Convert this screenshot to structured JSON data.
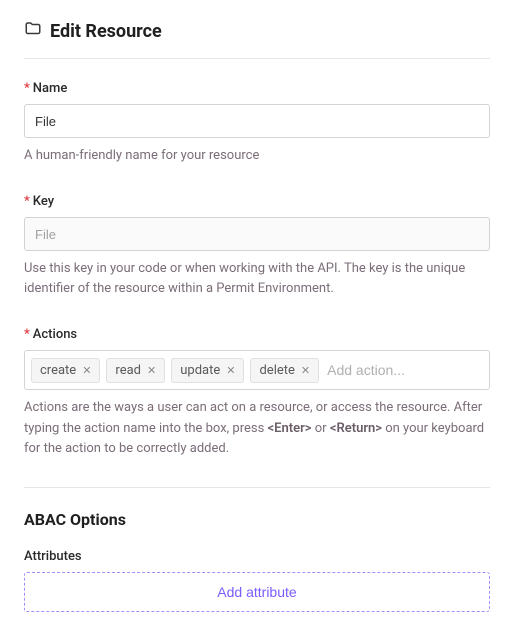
{
  "header": {
    "title": "Edit Resource",
    "icon": "folder-icon"
  },
  "fields": {
    "name": {
      "label": "Name",
      "required": true,
      "value": "File",
      "placeholder": "",
      "help": "A human-friendly name for your resource"
    },
    "key": {
      "label": "Key",
      "required": true,
      "value": "",
      "placeholder": "File",
      "help": "Use this key in your code or when working with the API. The key is the unique identifier of the resource within a Permit Environment."
    },
    "actions": {
      "label": "Actions",
      "required": true,
      "tags": [
        "create",
        "read",
        "update",
        "delete"
      ],
      "placeholder": "Add action...",
      "help_prefix": "Actions are the ways a user can act on a resource, or access the resource. After typing the action name into the box, press ",
      "help_enter": "<Enter>",
      "help_or": " or ",
      "help_return": "<Return>",
      "help_suffix": " on your keyboard for the action to be correctly added."
    }
  },
  "abac": {
    "title": "ABAC Options",
    "attributes_label": "Attributes",
    "add_button": "Add attribute"
  },
  "glyphs": {
    "required": "*",
    "close": "✕"
  }
}
